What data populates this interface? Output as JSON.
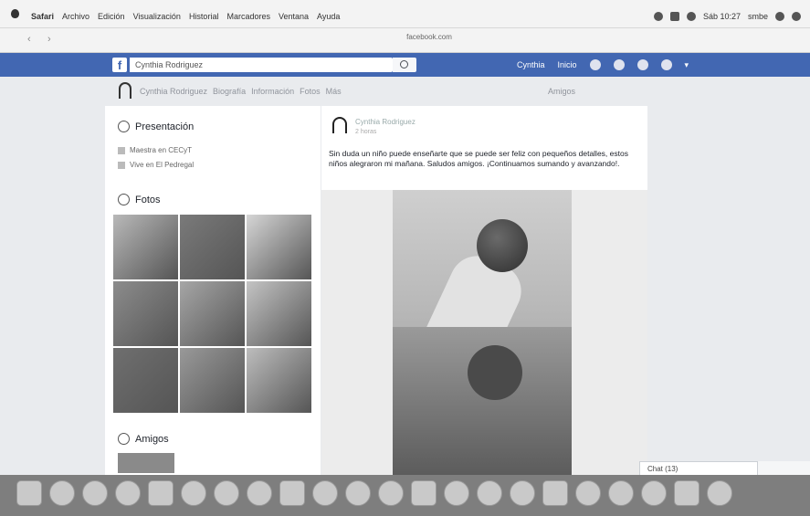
{
  "menubar": {
    "items": [
      "Safari",
      "Archivo",
      "Edición",
      "Visualización",
      "Historial",
      "Marcadores",
      "Ventana",
      "Ayuda"
    ],
    "status_text": "Sáb 10:27",
    "status_extra": "smbe"
  },
  "toolbar": {
    "back": "‹",
    "forward": "›",
    "url": "facebook.com"
  },
  "fb": {
    "logo": "f",
    "search_value": "Cynthia Rodriguez",
    "right_items": [
      "Cynthia",
      "Inicio"
    ]
  },
  "profile_nav": {
    "items": [
      "Cynthia Rodriguez",
      "Biografía",
      "Información",
      "Fotos",
      "Más"
    ],
    "friend_label": "Amigos"
  },
  "intro": {
    "title": "Presentación",
    "lines": [
      "Maestra en CECyT",
      "Vive en El Pedregal"
    ]
  },
  "photos": {
    "title": "Fotos",
    "shades": [
      "#b9b9b9",
      "#7a7a7a",
      "#d6d6d6",
      "#8c8c8c",
      "#a6a6a6",
      "#c4c4c4",
      "#6f6f6f",
      "#999999",
      "#bdbdbd"
    ]
  },
  "friends": {
    "title": "Amigos"
  },
  "post": {
    "author": "Cynthia Rodriguez",
    "time": "2 horas",
    "text": "Sin duda un niño puede enseñarte que se puede ser feliz con pequeños detalles, estos niños alegraron mi mañana. Saludos amigos. ¡Continuamos sumando y avanzando!."
  },
  "chat": {
    "label": "Chat (13)"
  }
}
